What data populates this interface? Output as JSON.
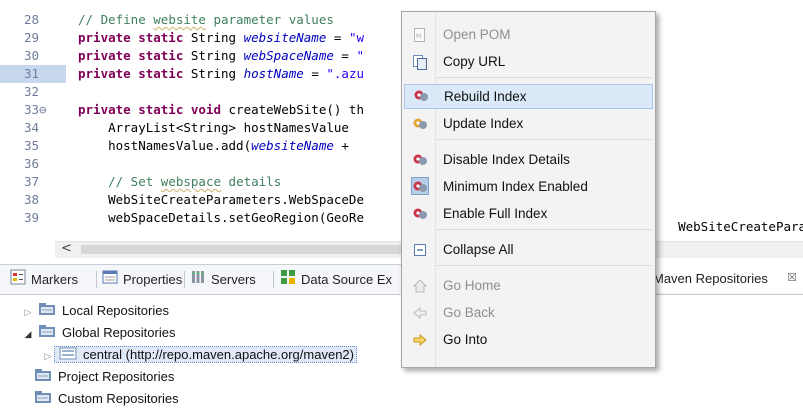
{
  "editor": {
    "lines": [
      {
        "n": "28",
        "segs": [
          [
            "cm",
            "// Define "
          ],
          [
            "cm u",
            "website"
          ],
          [
            "cm",
            " parameter values"
          ]
        ]
      },
      {
        "n": "29",
        "segs": [
          [
            "kw",
            "private static "
          ],
          [
            "tx",
            "String "
          ],
          [
            "fld",
            "websiteName"
          ],
          [
            "tx",
            " = "
          ],
          [
            "str",
            "\"w"
          ]
        ]
      },
      {
        "n": "30",
        "segs": [
          [
            "kw",
            "private static "
          ],
          [
            "tx",
            "String "
          ],
          [
            "fld",
            "webSpaceName"
          ],
          [
            "tx",
            " = "
          ],
          [
            "str",
            "\""
          ]
        ]
      },
      {
        "n": "31",
        "segs": [
          [
            "kw",
            "private static "
          ],
          [
            "tx",
            "String "
          ],
          [
            "fld",
            "hostName"
          ],
          [
            "tx",
            " = "
          ],
          [
            "str",
            "\".azu"
          ]
        ]
      },
      {
        "n": "32",
        "segs": []
      },
      {
        "n": "33⊖",
        "segs": [
          [
            "kw",
            "private static void "
          ],
          [
            "tx",
            "createWebSite() th"
          ]
        ]
      },
      {
        "n": "34",
        "segs": [
          [
            "tx",
            "    ArrayList<String> hostNamesValue "
          ]
        ]
      },
      {
        "n": "35",
        "segs": [
          [
            "tx",
            "    hostNamesValue.add("
          ],
          [
            "fld",
            "websiteName"
          ],
          [
            "tx",
            " + "
          ]
        ]
      },
      {
        "n": "36",
        "segs": []
      },
      {
        "n": "37",
        "segs": [
          [
            "cm",
            "    // Set "
          ],
          [
            "cm u",
            "webspace"
          ],
          [
            "cm",
            " details"
          ]
        ]
      },
      {
        "n": "38",
        "segs": [
          [
            "tx",
            "    WebSiteCreateParameters.WebSpaceDe"
          ]
        ]
      },
      {
        "n": "39",
        "segs": [
          [
            "tx",
            "    webSpaceDetails.setGeoRegion(GeoRe"
          ]
        ]
      }
    ],
    "overflow_text": "WebSiteCreateParam",
    "scroll_left": "<"
  },
  "panel": {
    "tabs": {
      "markers": "Markers",
      "properties": "Properties",
      "servers": "Servers",
      "data_source": "Data Source Ex",
      "maven": "Maven Repositories",
      "maven_close": "☒"
    },
    "tree": {
      "local": "Local Repositories",
      "global": "Global Repositories",
      "central": "central (http://repo.maven.apache.org/maven2)",
      "project": "Project Repositories",
      "custom": "Custom Repositories"
    }
  },
  "context_menu": {
    "open_pom": "Open POM",
    "copy_url": "Copy URL",
    "rebuild_index": "Rebuild Index",
    "update_index": "Update Index",
    "disable_index_details": "Disable Index Details",
    "minimum_index_enabled": "Minimum Index Enabled",
    "enable_full_index": "Enable Full Index",
    "collapse_all": "Collapse All",
    "go_home": "Go Home",
    "go_back": "Go Back",
    "go_into": "Go Into"
  },
  "colors": {
    "keyword": "#7f0055",
    "comment": "#3f7f5f",
    "field": "#0000c0",
    "string": "#2a00ff",
    "menu_highlight": "#dbe8f7"
  }
}
